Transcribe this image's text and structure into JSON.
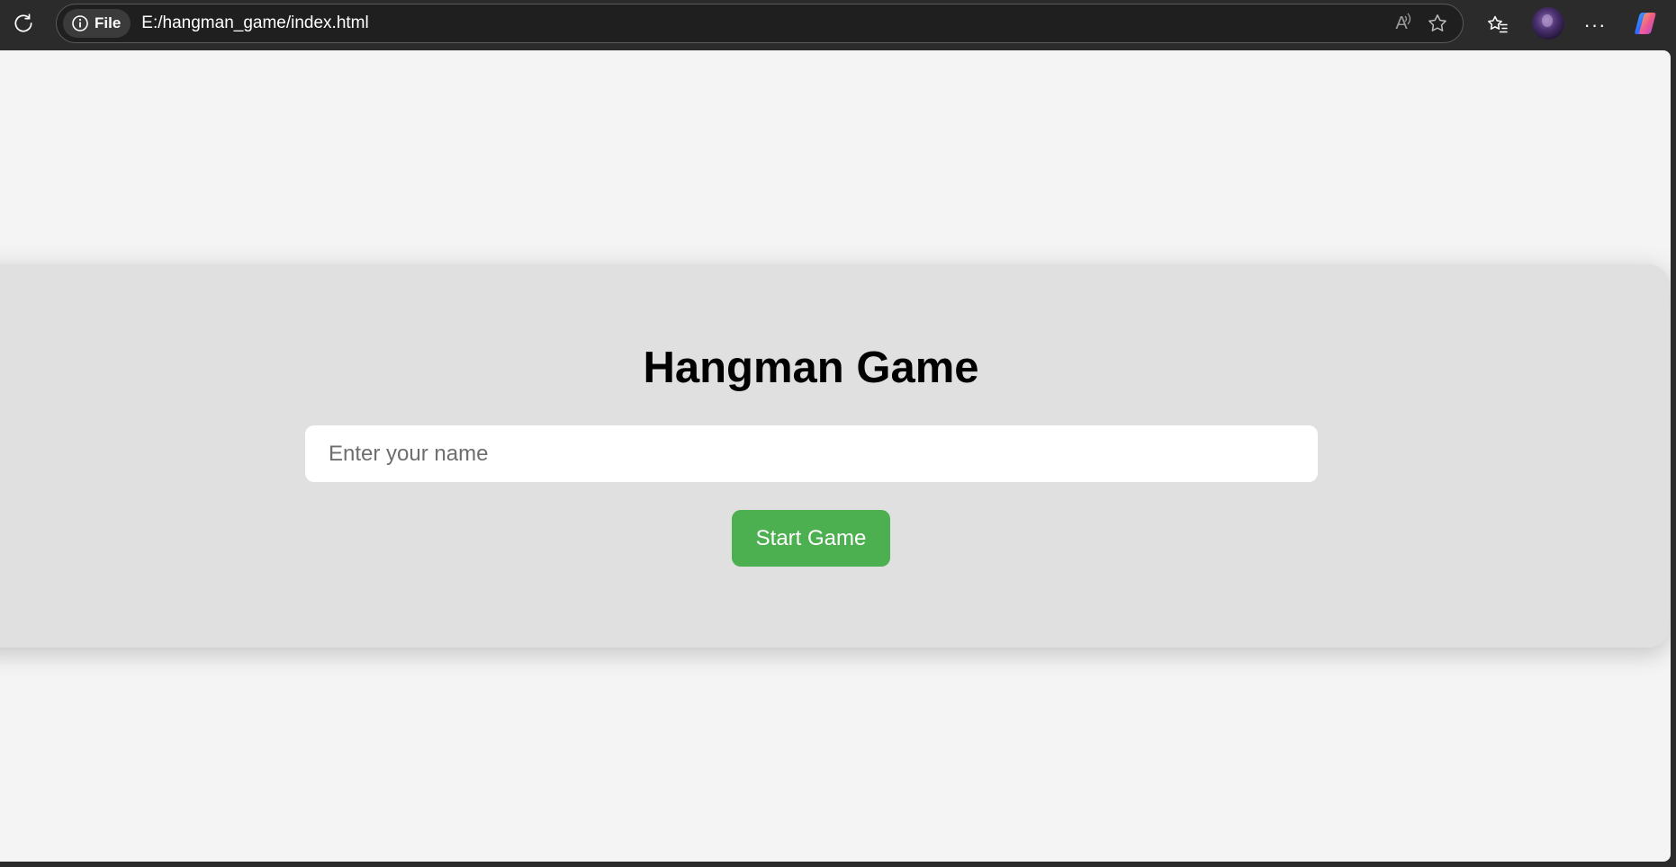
{
  "browser": {
    "site_info_label": "File",
    "url": "E:/hangman_game/index.html",
    "read_aloud_label": "A",
    "more_label": "···"
  },
  "page": {
    "title": "Hangman Game",
    "name_placeholder": "Enter your name",
    "name_value": "",
    "start_button_label": "Start Game"
  },
  "colors": {
    "background": "#f4f4f4",
    "card": "#e0e0e0",
    "start_button": "#4caf50",
    "browser_chrome": "#2b2b2b"
  }
}
